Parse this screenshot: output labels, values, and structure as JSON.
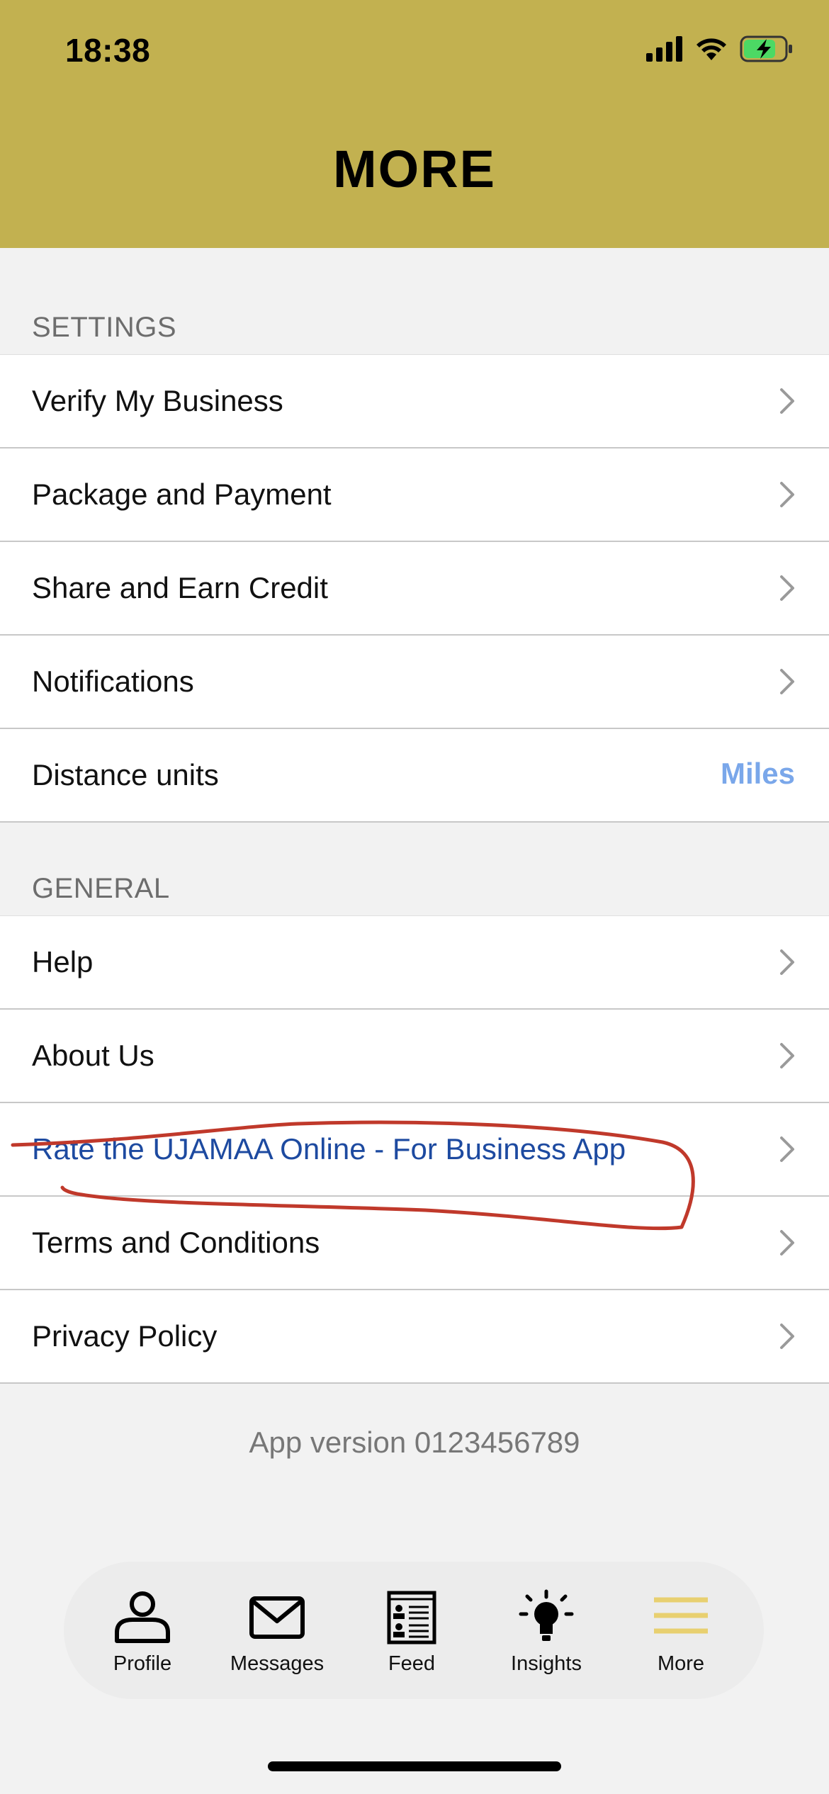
{
  "status_bar": {
    "time": "18:38",
    "icons": [
      "cellular-signal-icon",
      "wifi-icon",
      "battery-charging-icon"
    ]
  },
  "header": {
    "title": "MORE",
    "background_color": "#c2b150"
  },
  "settings": {
    "header": "SETTINGS",
    "items": [
      {
        "label": "Verify My Business"
      },
      {
        "label": "Package and Payment"
      },
      {
        "label": "Share and Earn Credit"
      },
      {
        "label": "Notifications"
      },
      {
        "label": "Distance units",
        "value": "Miles"
      }
    ]
  },
  "general": {
    "header": "GENERAL",
    "items": [
      {
        "label": "Help"
      },
      {
        "label": "About Us"
      },
      {
        "label": "Rate the UJAMAA Online - For Business App"
      },
      {
        "label": "Terms and Conditions"
      },
      {
        "label": "Privacy Policy"
      }
    ]
  },
  "footer": {
    "app_version": "App version 0123456789"
  },
  "tab_bar": {
    "tabs": [
      {
        "label": "Profile",
        "icon": "person-icon"
      },
      {
        "label": "Messages",
        "icon": "envelope-icon"
      },
      {
        "label": "Feed",
        "icon": "feed-icon"
      },
      {
        "label": "Insights",
        "icon": "lightbulb-icon"
      },
      {
        "label": "More",
        "icon": "hamburger-menu-icon",
        "selected": true
      }
    ],
    "active_color": "#e8d070"
  },
  "colors": {
    "accent_value": "#7aa7ea",
    "link": "#1d4aa0",
    "annotation": "#c0392b"
  }
}
